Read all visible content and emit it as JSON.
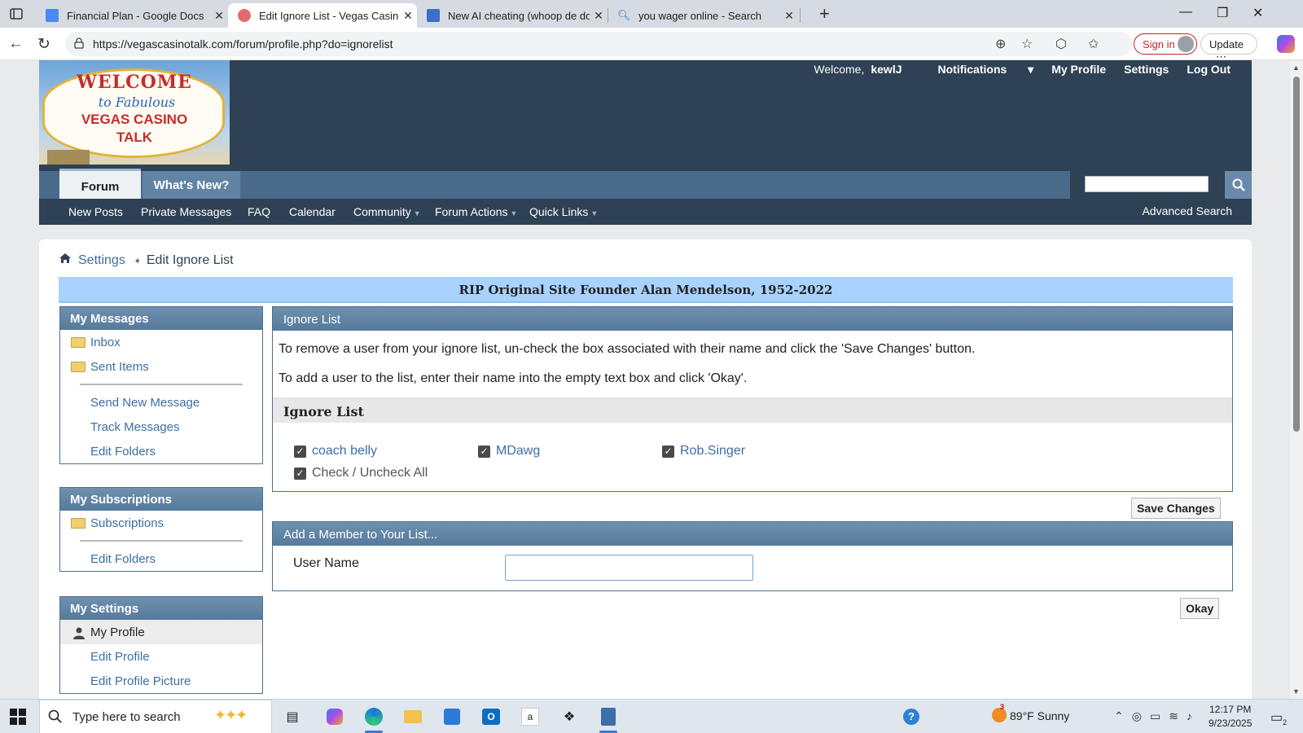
{
  "browser": {
    "tabs": [
      {
        "title": "Financial Plan - Google Docs",
        "icon": "google-docs-icon",
        "active": false
      },
      {
        "title": "Edit Ignore List - Vegas Casino Ta",
        "icon": "casino-talk-icon",
        "active": true
      },
      {
        "title": "New AI cheating (whoop de do) c",
        "icon": "forum-icon",
        "active": false
      },
      {
        "title": "you wager online - Search",
        "icon": "search-icon",
        "active": false
      }
    ],
    "url": "https://vegascasinotalk.com/forum/profile.php?do=ignorelist",
    "sign_in": "Sign in",
    "update": "Update"
  },
  "site": {
    "logo": {
      "line1": "WELCOME",
      "line2": "to Fabulous",
      "line3": "VEGAS CASINO",
      "line4": "TALK"
    },
    "top_nav": {
      "welcome": "Welcome,",
      "username": "kewlJ",
      "notifications": "Notifications",
      "my_profile": "My Profile",
      "settings": "Settings",
      "log_out": "Log Out"
    },
    "tabs": {
      "forum": "Forum",
      "whats_new": "What's New?"
    },
    "subnav": {
      "new_posts": "New Posts",
      "private_messages": "Private Messages",
      "faq": "FAQ",
      "calendar": "Calendar",
      "community": "Community",
      "forum_actions": "Forum Actions",
      "quick_links": "Quick Links",
      "advanced_search": "Advanced Search"
    }
  },
  "breadcrumb": {
    "parent": "Settings",
    "current": "Edit Ignore List"
  },
  "notice": "RIP Original Site Founder Alan Mendelson, 1952-2022",
  "sidebar": {
    "messages": {
      "title": "My Messages",
      "inbox": "Inbox",
      "sent": "Sent Items",
      "send_new": "Send New Message",
      "track": "Track Messages",
      "edit_folders": "Edit Folders"
    },
    "subscriptions": {
      "title": "My Subscriptions",
      "subscriptions": "Subscriptions",
      "edit_folders": "Edit Folders"
    },
    "settings": {
      "title": "My Settings",
      "my_profile": "My Profile",
      "edit_profile": "Edit Profile",
      "edit_picture": "Edit Profile Picture"
    }
  },
  "ignore": {
    "header": "Ignore List",
    "instruction1": "To remove a user from your ignore list, un-check the box associated with their name and click the 'Save Changes' button.",
    "instruction2": "To add a user to the list, enter their name into the empty text box and click 'Okay'.",
    "subheader": "Ignore List",
    "users": [
      {
        "name": "coach belly",
        "checked": true
      },
      {
        "name": "MDawg",
        "checked": true
      },
      {
        "name": "Rob.Singer",
        "checked": true
      }
    ],
    "check_all": "Check / Uncheck All",
    "save": "Save Changes"
  },
  "add_member": {
    "header": "Add a Member to Your List...",
    "label": "User Name",
    "value": "",
    "okay": "Okay"
  },
  "taskbar": {
    "search_placeholder": "Type here to search",
    "weather": "89°F  Sunny",
    "weather_badge": "3",
    "time": "12:17 PM",
    "date": "9/23/2025",
    "notification_count": "2"
  },
  "colors": {
    "header_bg": "#2f4154",
    "box_header": "#557a9c",
    "link": "#3b6ea5",
    "notice_bg": "#a8d2ff"
  }
}
